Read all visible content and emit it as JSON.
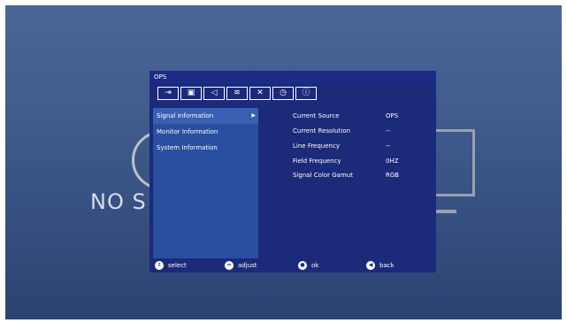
{
  "background": {
    "partial_text": "NO S"
  },
  "osd": {
    "title": "OPS",
    "tabs": [
      {
        "icon": "input-icon",
        "glyph": "⇥"
      },
      {
        "icon": "picture-icon",
        "glyph": "▣"
      },
      {
        "icon": "audio-icon",
        "glyph": "◁"
      },
      {
        "icon": "wifi-icon",
        "glyph": "≋"
      },
      {
        "icon": "tools-icon",
        "glyph": "✕"
      },
      {
        "icon": "clock-icon",
        "glyph": "◷"
      },
      {
        "icon": "info-icon",
        "glyph": "ⓘ"
      }
    ],
    "menu": [
      {
        "label": "Signal Information",
        "arrow": "▶"
      },
      {
        "label": "Monitor Information"
      },
      {
        "label": "System Information"
      }
    ],
    "info": [
      {
        "label": "Current Source",
        "value": "OPS"
      },
      {
        "label": "Current Resolution",
        "value": "--"
      },
      {
        "label": "Line Frequency",
        "value": "--"
      },
      {
        "label": "Field Frequency",
        "value": "0HZ"
      },
      {
        "label": "Signal Color Gamut",
        "value": "RGB"
      }
    ],
    "footer": {
      "select": "select",
      "adjust": "adjust",
      "ok": "ok",
      "back": "back"
    }
  },
  "colors": {
    "osd_bg": "#1c2a7a",
    "panel_bg": "#2b4fa0",
    "screen_bg": "#3a5486"
  }
}
